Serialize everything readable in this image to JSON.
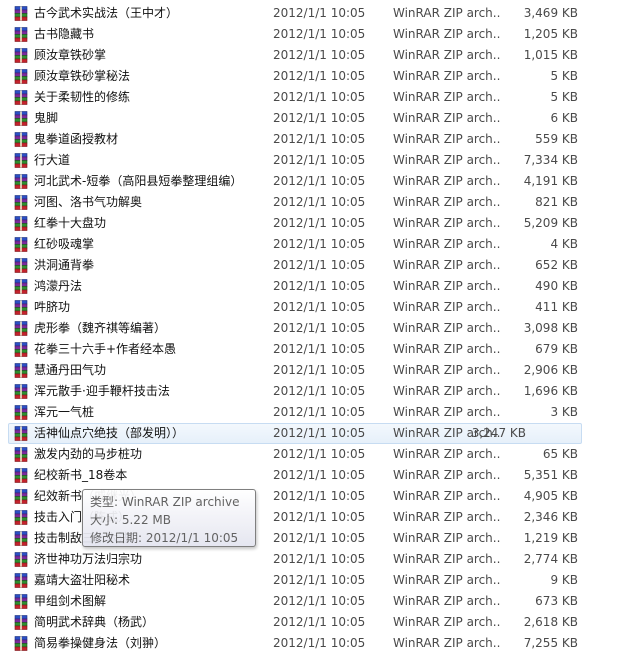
{
  "files": [
    {
      "name": "古今武术实战法（王中才）",
      "date": "2012/1/1 10:05",
      "type": "WinRAR ZIP arch...",
      "size": "3,469 KB"
    },
    {
      "name": "古书隐藏书",
      "date": "2012/1/1 10:05",
      "type": "WinRAR ZIP arch...",
      "size": "1,205 KB"
    },
    {
      "name": "顾汝章铁砂掌",
      "date": "2012/1/1 10:05",
      "type": "WinRAR ZIP arch...",
      "size": "1,015 KB"
    },
    {
      "name": "顾汝章铁砂掌秘法",
      "date": "2012/1/1 10:05",
      "type": "WinRAR ZIP arch...",
      "size": "5 KB"
    },
    {
      "name": "关于柔韧性的修练",
      "date": "2012/1/1 10:05",
      "type": "WinRAR ZIP arch...",
      "size": "5 KB"
    },
    {
      "name": "鬼脚",
      "date": "2012/1/1 10:05",
      "type": "WinRAR ZIP arch...",
      "size": "6 KB"
    },
    {
      "name": "鬼拳道函授教材",
      "date": "2012/1/1 10:05",
      "type": "WinRAR ZIP arch...",
      "size": "559 KB"
    },
    {
      "name": "行大道",
      "date": "2012/1/1 10:05",
      "type": "WinRAR ZIP arch...",
      "size": "7,334 KB"
    },
    {
      "name": "河北武术-短拳（高阳县短拳整理组编）",
      "date": "2012/1/1 10:05",
      "type": "WinRAR ZIP arch...",
      "size": "4,191 KB"
    },
    {
      "name": "河图、洛书气功解奥",
      "date": "2012/1/1 10:05",
      "type": "WinRAR ZIP arch...",
      "size": "821 KB"
    },
    {
      "name": "红拳十大盘功",
      "date": "2012/1/1 10:05",
      "type": "WinRAR ZIP arch...",
      "size": "5,209 KB"
    },
    {
      "name": "红砂吸魂掌",
      "date": "2012/1/1 10:05",
      "type": "WinRAR ZIP arch...",
      "size": "4 KB"
    },
    {
      "name": "洪洞通背拳",
      "date": "2012/1/1 10:05",
      "type": "WinRAR ZIP arch...",
      "size": "652 KB"
    },
    {
      "name": "鸿濛丹法",
      "date": "2012/1/1 10:05",
      "type": "WinRAR ZIP arch...",
      "size": "490 KB"
    },
    {
      "name": "吽脐功",
      "date": "2012/1/1 10:05",
      "type": "WinRAR ZIP arch...",
      "size": "411 KB"
    },
    {
      "name": "虎形拳（魏齐祺等编著）",
      "date": "2012/1/1 10:05",
      "type": "WinRAR ZIP arch...",
      "size": "3,098 KB"
    },
    {
      "name": "花拳三十六手+作者经本愚",
      "date": "2012/1/1 10:05",
      "type": "WinRAR ZIP arch...",
      "size": "679 KB"
    },
    {
      "name": "慧通丹田气功",
      "date": "2012/1/1 10:05",
      "type": "WinRAR ZIP arch...",
      "size": "2,906 KB"
    },
    {
      "name": "浑元散手·迎手鞭杆技击法",
      "date": "2012/1/1 10:05",
      "type": "WinRAR ZIP arch...",
      "size": "1,696 KB"
    },
    {
      "name": "浑元一气桩",
      "date": "2012/1/1 10:05",
      "type": "WinRAR ZIP arch...",
      "size": "3 KB"
    },
    {
      "name": "活神仙点穴绝技（部发明））",
      "date": "2012/1/1 10:05",
      "type": "WinRAR ZIP arch...",
      "size": "3,247 KB"
    },
    {
      "name": "激发内劲的马步桩功",
      "date": "2012/1/1 10:05",
      "type": "WinRAR ZIP arch...",
      "size": "65 KB"
    },
    {
      "name": "纪校新书_18卷本",
      "date": "2012/1/1 10:05",
      "type": "WinRAR ZIP arch...",
      "size": "5,351 KB"
    },
    {
      "name": "纪效新书（戚继光）",
      "date": "2012/1/1 10:05",
      "type": "WinRAR ZIP arch...",
      "size": "4,905 KB"
    },
    {
      "name": "技击入门（陈式）",
      "date": "2012/1/1 10:05",
      "type": "WinRAR ZIP arch...",
      "size": "2,346 KB"
    },
    {
      "name": "技击制敌三十六法",
      "date": "2012/1/1 10:05",
      "type": "WinRAR ZIP arch...",
      "size": "1,219 KB"
    },
    {
      "name": "济世神功万法归宗功",
      "date": "2012/1/1 10:05",
      "type": "WinRAR ZIP arch...",
      "size": "2,774 KB"
    },
    {
      "name": "嘉靖大盗壮阳秘术",
      "date": "2012/1/1 10:05",
      "type": "WinRAR ZIP arch...",
      "size": "9 KB"
    },
    {
      "name": "甲组剑术图解",
      "date": "2012/1/1 10:05",
      "type": "WinRAR ZIP arch...",
      "size": "673 KB"
    },
    {
      "name": "简明武术辞典（杨武）",
      "date": "2012/1/1 10:05",
      "type": "WinRAR ZIP arch...",
      "size": "2,618 KB"
    },
    {
      "name": "简易拳操健身法（刘翀）",
      "date": "2012/1/1 10:05",
      "type": "WinRAR ZIP arch...",
      "size": "7,255 KB"
    }
  ],
  "hover_index": 20,
  "tooltip": {
    "type_line": "类型: WinRAR ZIP archive",
    "size_line": "大小: 5.22 MB",
    "date_line": "修改日期: 2012/1/1 10:05"
  },
  "colors": {
    "hover_bg": "#e6f0fa",
    "hover_border": "#c7dcf2",
    "book_blue": "#2b4fc4",
    "book_purple": "#7a2a9c",
    "book_green": "#2f8f2f",
    "book_red": "#c4232c"
  }
}
